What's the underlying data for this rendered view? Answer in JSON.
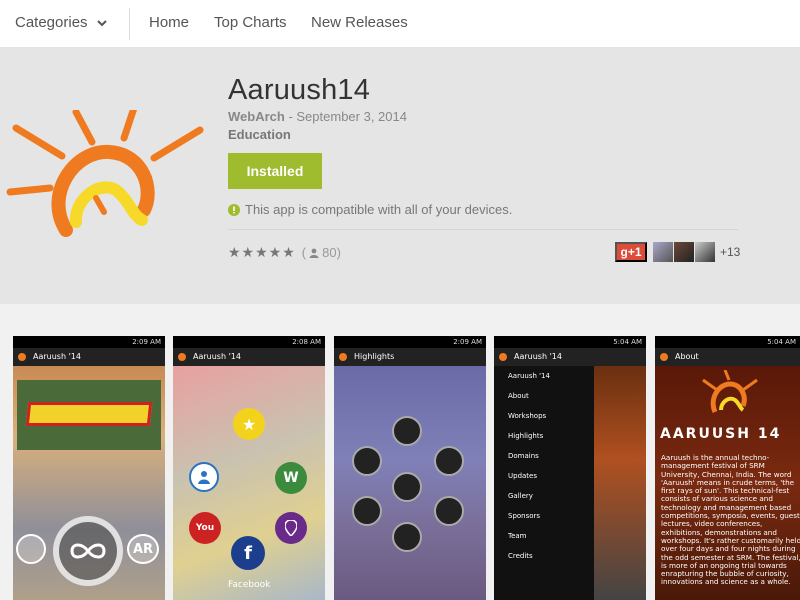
{
  "nav": {
    "categories_label": "Categories",
    "links": [
      "Home",
      "Top Charts",
      "New Releases"
    ]
  },
  "app": {
    "title": "Aaruush14",
    "developer": "WebArch",
    "date_sep": " - ",
    "date": "September 3, 2014",
    "category": "Education",
    "install_label": "Installed",
    "compat_text": "This app is compatible with all of your devices.",
    "stars": "★★★★★",
    "rating_count": "(",
    "rating_num": "80)",
    "gplus_label": "g+1",
    "plus_count": "+13"
  },
  "screenshots": [
    {
      "time": "2:09 AM",
      "title": "Aaruush '14"
    },
    {
      "time": "2:08 AM",
      "title": "Aaruush '14",
      "facebook_label": "Facebook"
    },
    {
      "time": "2:09 AM",
      "title": "Highlights"
    },
    {
      "time": "5:04 AM",
      "title": "Aaruush '14",
      "drawer": [
        "Aaruush '14",
        "About",
        "Workshops",
        "Highlights",
        "Domains",
        "Updates",
        "Gallery",
        "Sponsors",
        "Team",
        "Credits"
      ]
    },
    {
      "time": "5:04 AM",
      "title": "About",
      "brand": "AARUUSH 14",
      "about": "Aaruush is the annual techno-management festival of SRM University, Chennai, India. The word 'Aaruush' means in crude terms, 'the first rays of sun'. This technical-fest consists of various science and technology and management based competitions, symposia, events, guest lectures, video conferences, exhibitions, demonstrations and workshops. It's rather customarily held over four days and four nights during the odd semester at SRM. The festival, is more of an ongoing trial towards enrapturing the bubble of curiosity, innovations and science as a whole."
    }
  ],
  "colors": {
    "install_green": "#9fbb2e",
    "gplus_red": "#dd4b39",
    "logo_orange": "#f07a1f",
    "logo_yellow": "#f7d92a"
  }
}
